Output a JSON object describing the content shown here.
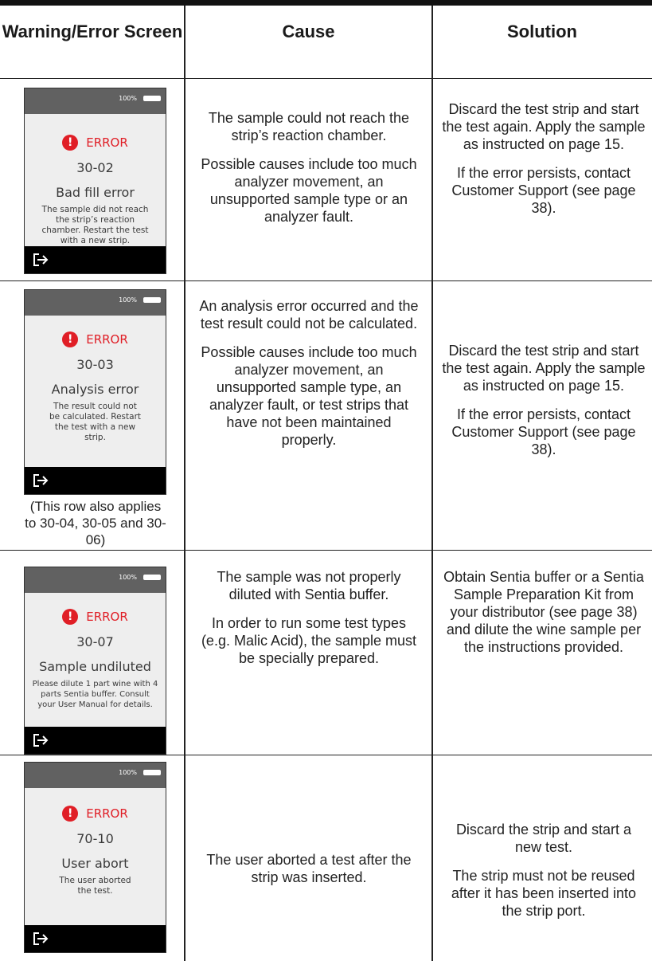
{
  "header": {
    "screen": "Warning/Error Screen",
    "cause": "Cause",
    "solution": "Solution"
  },
  "icons": {
    "error": "exclamation-circle-icon",
    "exit": "exit-arrow-icon",
    "battery": "battery-icon"
  },
  "colors": {
    "error_red": "#e01e26",
    "status_bar": "#616161",
    "screen_bg": "#eeeeee"
  },
  "rows": [
    {
      "screen": {
        "battery": "100%",
        "error_label": "ERROR",
        "code": "30-02",
        "title": "Bad fill error",
        "description": "The sample did not reach the strip’s reaction chamber. Restart the test with a new strip."
      },
      "cause": [
        "The sample could not reach the strip’s reaction chamber.",
        "Possible causes include too much analyzer movement, an unsupported sample type or an analyzer fault."
      ],
      "solution": [
        "Discard the test strip and start the test again. Apply the sample as instructed on page 15.",
        "If the error persists, contact Customer Support (see page 38)."
      ]
    },
    {
      "screen": {
        "battery": "100%",
        "error_label": "ERROR",
        "code": "30-03",
        "title": "Analysis error",
        "description": "The result could not be calculated. Restart the test with a new strip."
      },
      "note": "(This row also applies to 30-04, 30-05 and 30-06)",
      "cause": [
        "An analysis error occurred and the test result could not be calculated.",
        "Possible causes include too much analyzer movement, an unsupported sample type, an analyzer fault, or test strips that have not been maintained properly."
      ],
      "solution": [
        "Discard the test strip and start the test again. Apply the sample as instructed on page 15.",
        "If the error persists, contact Customer Support (see page 38)."
      ]
    },
    {
      "screen": {
        "battery": "100%",
        "error_label": "ERROR",
        "code": "30-07",
        "title": "Sample undiluted",
        "description": "Please dilute 1 part wine with 4 parts Sentia buffer. Consult your User Manual for details."
      },
      "cause": [
        "The sample was not properly diluted with Sentia buffer.",
        "In order to run some test types (e.g. Malic Acid), the sample must be specially prepared."
      ],
      "solution": [
        "Obtain Sentia buffer or a Sentia Sample Preparation Kit from your distributor (see page 38) and dilute the wine sample per the instructions provided."
      ]
    },
    {
      "screen": {
        "battery": "100%",
        "error_label": "ERROR",
        "code": "70-10",
        "title": "User abort",
        "description": "The user aborted the test."
      },
      "cause": [
        "The user aborted a test after the strip was inserted."
      ],
      "solution": [
        "Discard the strip and start a new test.",
        "The strip must not be reused after it has been inserted into the strip port."
      ]
    }
  ]
}
